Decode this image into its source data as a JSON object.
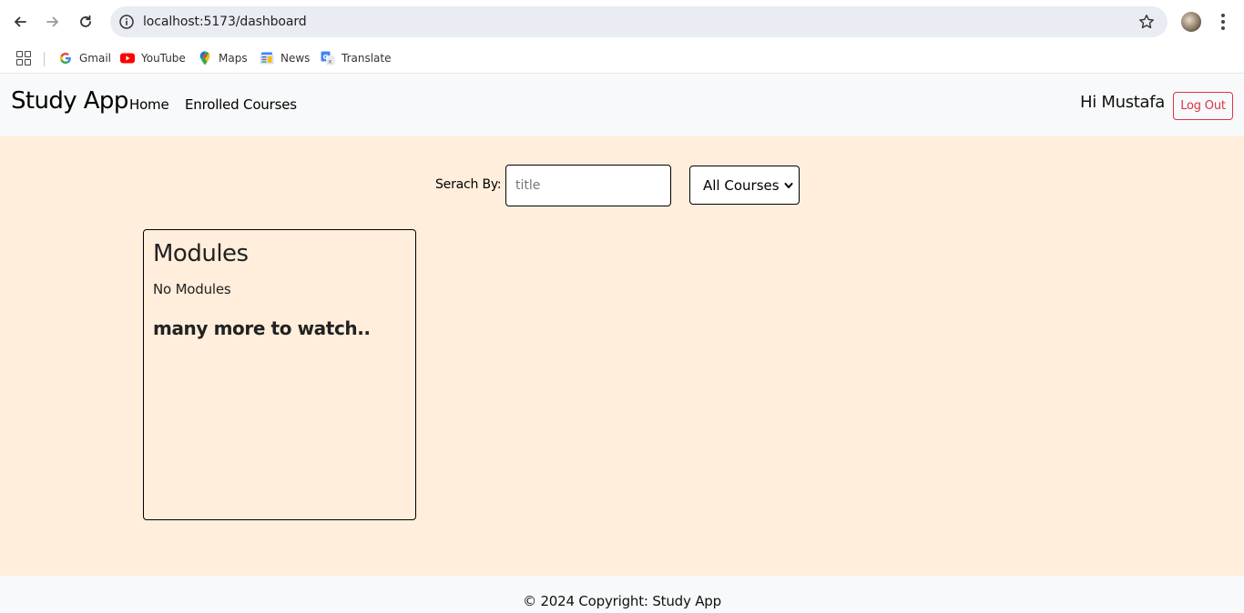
{
  "browser": {
    "url": "localhost:5173/dashboard",
    "bookmarks": [
      {
        "label": "Gmail",
        "icon": "gmail-icon"
      },
      {
        "label": "YouTube",
        "icon": "youtube-icon"
      },
      {
        "label": "Maps",
        "icon": "maps-icon"
      },
      {
        "label": "News",
        "icon": "news-icon"
      },
      {
        "label": "Translate",
        "icon": "translate-icon"
      }
    ]
  },
  "header": {
    "brand": "Study App",
    "nav": [
      "Home",
      "Enrolled Courses"
    ],
    "greeting": "Hi Mustafa",
    "logout_label": "Log Out"
  },
  "search": {
    "label": "Serach By:",
    "placeholder": "title",
    "value": "",
    "filter_selected": "All Courses"
  },
  "card": {
    "title": "Modules",
    "empty_text": "No Modules",
    "more_text": "many more to watch.."
  },
  "footer": {
    "text": "© 2024 Copyright: Study App"
  },
  "colors": {
    "page_bg": "#ffeedb",
    "header_bg": "#f8f9fa",
    "logout": "#dc3545"
  }
}
